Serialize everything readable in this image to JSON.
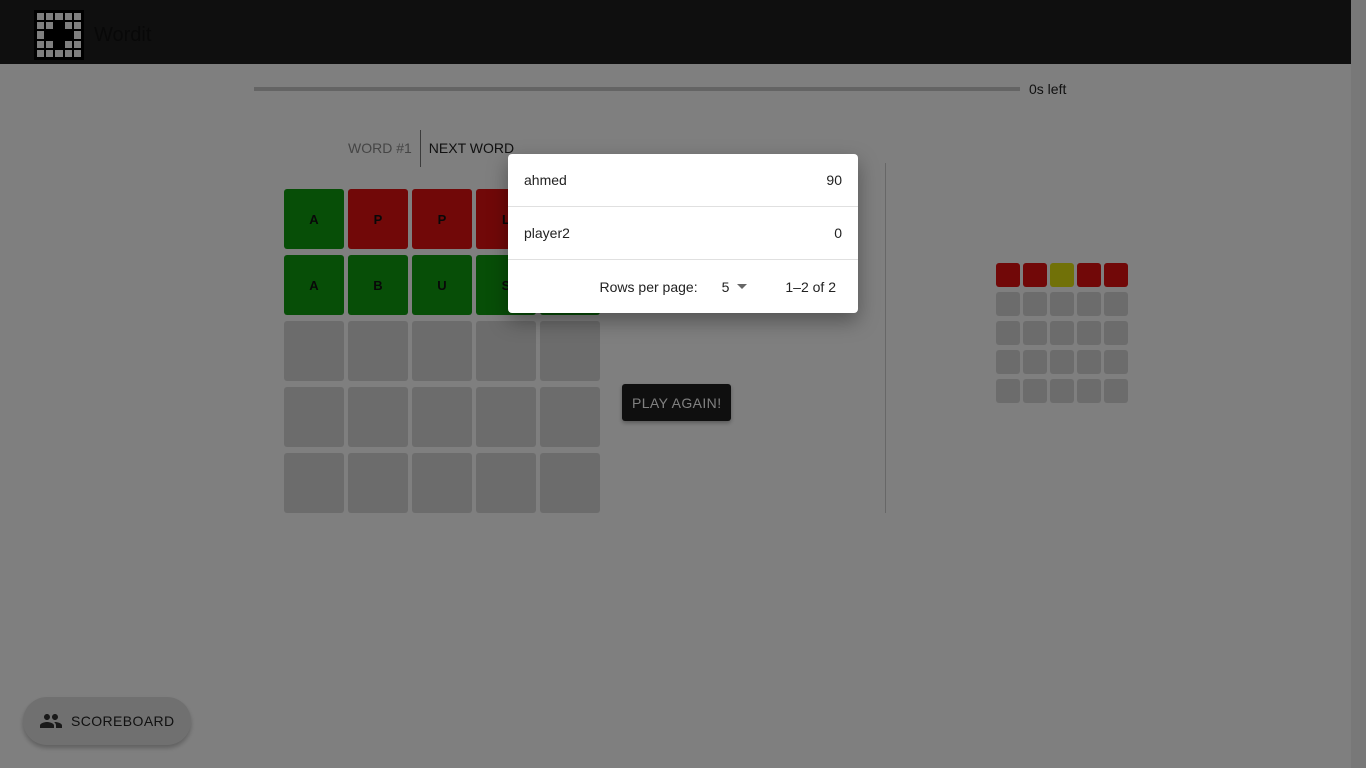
{
  "app": {
    "title": "Wordit"
  },
  "timer": {
    "text": "0s left",
    "progress": 0
  },
  "tabs": [
    {
      "label": "Word #1",
      "active": false
    },
    {
      "label": "Next Word",
      "active": true
    }
  ],
  "board": {
    "rows": [
      [
        {
          "letter": "A",
          "state": "green"
        },
        {
          "letter": "P",
          "state": "red"
        },
        {
          "letter": "P",
          "state": "red"
        },
        {
          "letter": "L",
          "state": "red"
        },
        {
          "letter": "",
          "state": "red"
        }
      ],
      [
        {
          "letter": "A",
          "state": "green"
        },
        {
          "letter": "B",
          "state": "green"
        },
        {
          "letter": "U",
          "state": "green"
        },
        {
          "letter": "S",
          "state": "green"
        },
        {
          "letter": "",
          "state": "green"
        }
      ],
      [
        {
          "letter": "",
          "state": "empty"
        },
        {
          "letter": "",
          "state": "empty"
        },
        {
          "letter": "",
          "state": "empty"
        },
        {
          "letter": "",
          "state": "empty"
        },
        {
          "letter": "",
          "state": "empty"
        }
      ],
      [
        {
          "letter": "",
          "state": "empty"
        },
        {
          "letter": "",
          "state": "empty"
        },
        {
          "letter": "",
          "state": "empty"
        },
        {
          "letter": "",
          "state": "empty"
        },
        {
          "letter": "",
          "state": "empty"
        }
      ],
      [
        {
          "letter": "",
          "state": "empty"
        },
        {
          "letter": "",
          "state": "empty"
        },
        {
          "letter": "",
          "state": "empty"
        },
        {
          "letter": "",
          "state": "empty"
        },
        {
          "letter": "",
          "state": "empty"
        }
      ]
    ]
  },
  "opponent_board": {
    "rows": [
      [
        "red",
        "red",
        "yellow",
        "red",
        "red"
      ],
      [
        "empty",
        "empty",
        "empty",
        "empty",
        "empty"
      ],
      [
        "empty",
        "empty",
        "empty",
        "empty",
        "empty"
      ],
      [
        "empty",
        "empty",
        "empty",
        "empty",
        "empty"
      ],
      [
        "empty",
        "empty",
        "empty",
        "empty",
        "empty"
      ]
    ]
  },
  "play_again_label": "Play again!",
  "scoreboard_label": "Scoreboard",
  "scores": {
    "rows": [
      {
        "player": "ahmed",
        "score": "90"
      },
      {
        "player": "player2",
        "score": "0"
      }
    ],
    "rows_per_page_label": "Rows per page:",
    "rows_per_page": "5",
    "range": "1–2 of 2"
  },
  "colors": {
    "green": "#0f9d0f",
    "red": "#e31010",
    "yellow": "#e3e310",
    "empty": "#d9d9d9",
    "appbar": "#1e1e1e"
  },
  "icons": {
    "scoreboard": "people-icon",
    "select": "chevron-down-icon"
  }
}
